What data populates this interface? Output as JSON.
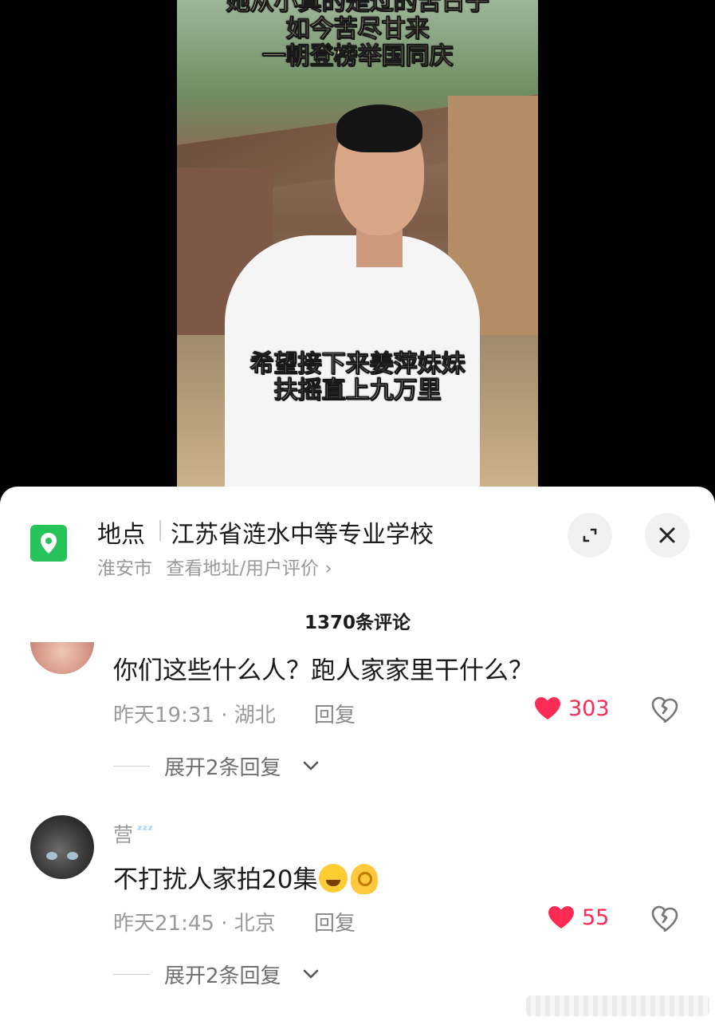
{
  "video": {
    "caption_top": [
      "她从小真的是过的苦日子",
      "如今苦尽甘来",
      "一朝登榜举国同庆"
    ],
    "caption_bottom": [
      "希望接下来姜萍妹妹",
      "扶摇直上九万里"
    ]
  },
  "location": {
    "prefix": "地点",
    "name": "江苏省涟水中等专业学校",
    "city": "淮安市",
    "link": "查看地址/用户评价",
    "link_chevron": "›"
  },
  "comments_header": {
    "count_label": "1370条评论"
  },
  "comments": [
    {
      "name": "",
      "text": "你们这些什么人？跑人家家里干什么？",
      "meta": "昨天19:31 · 湖北",
      "reply_label": "回复",
      "likes": "303",
      "expand_label": "展开2条回复"
    },
    {
      "name": "营",
      "text": "不打扰人家拍20集",
      "meta": "昨天21:45 · 北京",
      "reply_label": "回复",
      "likes": "55",
      "expand_label": "展开2条回复"
    }
  ],
  "colors": {
    "like": "#fe2c55",
    "poi_green": "#27c25a"
  },
  "icons": [
    "location-pin-icon",
    "expand-icon",
    "close-icon",
    "heart-icon",
    "broken-heart-icon",
    "chevron-down-icon",
    "zzz-icon",
    "laugh-cry-emoji-icon",
    "ok-hand-emoji-icon"
  ]
}
